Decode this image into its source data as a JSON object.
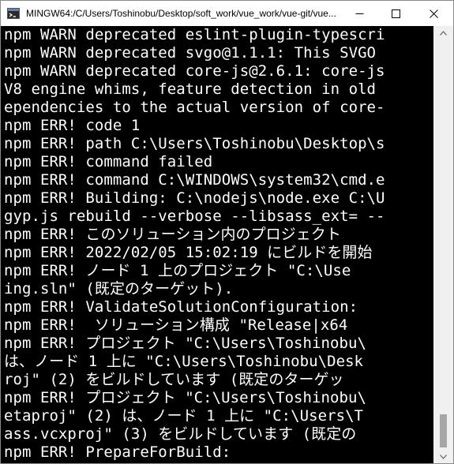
{
  "window": {
    "title": "MINGW64:/C/Users/Toshinobu/Desktop/soft_work/vue_work/vue-git/vue...",
    "app_icon": "mingw-terminal-icon",
    "controls": {
      "minimize_icon": "minimize-icon",
      "maximize_icon": "maximize-icon",
      "close_icon": "close-icon"
    }
  },
  "terminal": {
    "lines": [
      "npm WARN deprecated eslint-plugin-typescri",
      "npm WARN deprecated svgo@1.1.1: This SVGO",
      "npm WARN deprecated core-js@2.6.1: core-js",
      "V8 engine whims, feature detection in old",
      "ependencies to the actual version of core-",
      "npm ERR! code 1",
      "npm ERR! path C:\\Users\\Toshinobu\\Desktop\\s",
      "npm ERR! command failed",
      "npm ERR! command C:\\WINDOWS\\system32\\cmd.e",
      "npm ERR! Building: C:\\nodejs\\node.exe C:\\U",
      "gyp.js rebuild --verbose --libsass_ext= --",
      "npm ERR! このソリューション内のプロジェクト",
      "npm ERR! 2022/02/05 15:02:19 にビルドを開始",
      "npm ERR! ノード 1 上のプロジェクト \"C:\\Use",
      "ing.sln\" (既定のターゲット).",
      "npm ERR! ValidateSolutionConfiguration:",
      "npm ERR!  ソリューション構成 \"Release|x64",
      "npm ERR! プロジェクト \"C:\\Users\\Toshinobu\\",
      "は、ノード 1 上に \"C:\\Users\\Toshinobu\\Desk",
      "roj\" (2) をビルドしています (既定のターゲッ",
      "npm ERR! プロジェクト \"C:\\Users\\Toshinobu\\",
      "etaproj\" (2) は、ノード 1 上に \"C:\\Users\\T",
      "ass.vcxproj\" (3) をビルドしています (既定の",
      "npm ERR! PrepareForBuild:"
    ]
  },
  "scrollbar": {
    "up_icon": "scroll-up-arrow-icon",
    "down_icon": "scroll-down-arrow-icon",
    "position": 0.97
  }
}
